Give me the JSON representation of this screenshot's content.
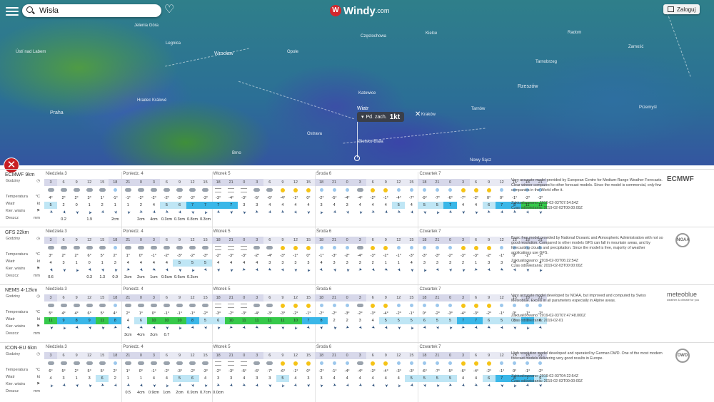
{
  "search": {
    "value": "Wisła"
  },
  "app": {
    "logo_letter": "W",
    "name": "Windy",
    "domain": ".com"
  },
  "login_label": "Zaloguj",
  "map": {
    "cities": [
      "Jelenia Góra",
      "Legnica",
      "Wrocław",
      "Ústí nad Labem",
      "Opole",
      "Częstochowa",
      "Kielce",
      "Radom",
      "Zamość",
      "Tarnobrzeg",
      "Rzeszów",
      "Hradec Králové",
      "Praha",
      "Katowice",
      "Kraków",
      "Ostrava",
      "Bielsko-Biała",
      "Brno",
      "Nowy Sącz",
      "Tarnów",
      "Przemyśl"
    ],
    "wind_title": "Wiatr",
    "wind_dir": "Pd. zach.",
    "wind_value": "1kt"
  },
  "colors": {
    "accent": "#d4272d",
    "hours_bg": "#e8e9f3",
    "wind_strong": "#35c94a",
    "wind_mid": "#3ab7e8"
  },
  "row_labels": {
    "hours": "Godziny",
    "temperature": "Temperatura",
    "temp_unit": "°C",
    "wind": "Wiatr",
    "wind_unit": "kt",
    "wind_dir": "Kier. wiatru",
    "precip": "Deszcz",
    "precip_unit": "mm"
  },
  "days": [
    "Niedziela 3",
    "Poniedz. 4",
    "Wtorek 5",
    "Środa 6",
    "Czwartek 7"
  ],
  "hours": [
    "3",
    "6",
    "9",
    "12",
    "15",
    "18",
    "21",
    "0",
    "3",
    "6",
    "9",
    "12",
    "15",
    "18",
    "21",
    "0",
    "3",
    "6",
    "9",
    "12",
    "15",
    "18",
    "21",
    "0",
    "3",
    "6",
    "9",
    "12",
    "15",
    "18",
    "21",
    "0",
    "3",
    "6",
    "9",
    "12",
    "15",
    "18",
    "21"
  ],
  "models": [
    {
      "name": "ECMWF 9km",
      "logo": "ECMWF",
      "description": "Very accurate model provided by European Centre for Medium-Range Weather Forecasts. Clear winner compared to other forecast models. Since the model is commercial, only few companies in the World offer it.",
      "updated": "Zaktualizowano: 2019-02-03T07:54:54Z",
      "refresh": "Czas odświeżania: 2019-02-03T00:00:00Z",
      "temps": [
        "4°",
        "2°",
        "2°",
        "3°",
        "1°",
        "-1°",
        "-1°",
        "-2°",
        "-2°",
        "-2°",
        "-3°",
        "-2°",
        "-3°",
        "-3°",
        "-4°",
        "-3°",
        "-5°",
        "-6°",
        "-4°",
        "-1°",
        "0°",
        "-2°",
        "-5°",
        "-4°",
        "-4°",
        "-2°",
        "-1°",
        "-4°",
        "-7°",
        "-9°",
        "-7°",
        "-6°",
        "-7°",
        "-2°",
        "0°",
        "0°",
        "-1°",
        "-2°",
        "-3°"
      ],
      "wind": [
        "5",
        "2",
        "0",
        "1",
        "2",
        "1",
        "1",
        "2",
        "4",
        "5",
        "6",
        "7",
        "7",
        "7",
        "7",
        "3",
        "3",
        "4",
        "4",
        "4",
        "4",
        "3",
        "4",
        "3",
        "4",
        "4",
        "4",
        "5",
        "4",
        "5",
        "5",
        "7",
        "4",
        "4",
        "6",
        "7",
        "8",
        "11",
        "11"
      ],
      "rain": [
        "",
        "0.2",
        "",
        "1.9",
        "",
        "2cm",
        "",
        "2cm",
        "4cm",
        "0.3cm",
        "0.3cm",
        "0.8cm",
        "0.3cm",
        "",
        "",
        "",
        "",
        "",
        "",
        "",
        "",
        "",
        "",
        "",
        "",
        "",
        "",
        "",
        "",
        "",
        "",
        "",
        "",
        "",
        "",
        "",
        "",
        "",
        ""
      ]
    },
    {
      "name": "GFS 22km",
      "logo": "NOAA",
      "description": "Basic free model provided by National Oceanic and Atmospheric Administration with not so good resolution. Compared to other models GFS can fall in mountain areas, and by forecasting clouds and precipitation. Since the model is free, majority of weather applications use GFS.",
      "updated": "Zaktualizowano: 2019-02-03T06:22:54Z",
      "refresh": "Czas odświeżania: 2019-02-03T00:00:00Z",
      "temps": [
        "3°",
        "2°",
        "2°",
        "6°",
        "5°",
        "2°",
        "1°",
        "0°",
        "-1°",
        "-2°",
        "-3°",
        "-2°",
        "-3°",
        "-2°",
        "-3°",
        "-3°",
        "-2°",
        "-4°",
        "-3°",
        "-1°",
        "0°",
        "-1°",
        "-3°",
        "-2°",
        "-4°",
        "-3°",
        "-2°",
        "-1°",
        "-3°",
        "-3°",
        "-3°",
        "-2°",
        "-3°",
        "-3°",
        "-2°",
        "-1°",
        "0°",
        "-1°",
        "-1°"
      ],
      "wind": [
        "4",
        "3",
        "1",
        "0",
        "1",
        "3",
        "4",
        "4",
        "4",
        "4",
        "5",
        "5",
        "5",
        "4",
        "4",
        "4",
        "4",
        "3",
        "3",
        "3",
        "3",
        "4",
        "3",
        "3",
        "3",
        "2",
        "1",
        "1",
        "4",
        "3",
        "3",
        "3",
        "2",
        "1",
        "3",
        "3",
        "4",
        "3",
        "4"
      ],
      "rain": [
        "0.6",
        "",
        "",
        "0.3",
        "1.3",
        "0.9",
        "2cm",
        "2cm",
        "1cm",
        "0.5cm",
        "0.6cm",
        "0.3cm",
        "",
        "",
        "",
        "",
        "",
        "",
        "",
        "",
        "",
        "",
        "",
        "",
        "",
        "",
        "",
        "",
        "",
        "",
        "",
        "",
        "",
        "",
        "",
        "",
        "",
        "",
        ""
      ]
    },
    {
      "name": "NEMS 4-12km",
      "logo": "meteoblue",
      "logo_sub": "weather & climate for you",
      "description": "Very accurate model developed by NOAA, but improved and computed by Swiss Meteoblue. Excels in all parameters especially in Alpine areas.",
      "updated": "Zaktualizowano: 2019-02-03T07:47:48.000Z",
      "refresh": "Czas odświeżania: 2019-02-01",
      "temps": [
        "5°",
        "4°",
        "4°",
        "6°",
        "5°",
        "4°",
        "2°",
        "1°",
        "0°",
        "-1°",
        "-1°",
        "-1°",
        "-2°",
        "-3°",
        "-2°",
        "-3°",
        "-4°",
        "-3°",
        "-3°",
        "-2°",
        "-1°",
        "-2°",
        "-2°",
        "-3°",
        "-2°",
        "-3°",
        "-4°",
        "-2°",
        "-1°",
        "0°",
        "-2°",
        "-3°",
        "-4°",
        "-3°",
        "-2°",
        "-1°",
        "0°",
        "-1°",
        "-2°"
      ],
      "wind": [
        "11",
        "9",
        "8",
        "9",
        "11",
        "8",
        "4",
        "6",
        "10",
        "10",
        "10",
        "8",
        "5",
        "6",
        "10",
        "11",
        "11",
        "11",
        "11",
        "10",
        "7",
        "8",
        "2",
        "2",
        "3",
        "4",
        "5",
        "5",
        "5",
        "6",
        "5",
        "5",
        "7",
        "7",
        "6",
        "5",
        "6",
        "7",
        "6"
      ],
      "rain": [
        "",
        "",
        "",
        "",
        "",
        "",
        "3cm",
        "4cm",
        "2cm",
        "0.7",
        "",
        "",
        "",
        "",
        "",
        "",
        "",
        "",
        "",
        "",
        "",
        "",
        "",
        "",
        "",
        "",
        "",
        "",
        "",
        "",
        "",
        "",
        "",
        "",
        "",
        "",
        "",
        "",
        ""
      ]
    },
    {
      "name": "ICON-EU 6km",
      "logo": "DWD",
      "description": "High resolution model developed and operated by German DWD. One of the most modern forecast models delivering very good results in Europe.",
      "updated": "Zaktualizowano: 2019-02-03T04:22:54Z",
      "refresh": "Czas odświeżania: 2019-02-03T00:00:00Z",
      "temps": [
        "6°",
        "5°",
        "2°",
        "5°",
        "5°",
        "2°",
        "1°",
        "0°",
        "-1°",
        "-2°",
        "-3°",
        "-2°",
        "-3°",
        "-2°",
        "-3°",
        "-5°",
        "-6°",
        "-7°",
        "-6°",
        "-1°",
        "0°",
        "-2°",
        "-1°",
        "-4°",
        "-4°",
        "-3°",
        "-4°",
        "-3°",
        "-3°",
        "-6°",
        "-7°",
        "-5°",
        "-6°",
        "-4°",
        "-2°",
        "-1°",
        "0°",
        "-1°",
        "-2°"
      ],
      "wind": [
        "4",
        "3",
        "1",
        "3",
        "6",
        "2",
        "1",
        "1",
        "4",
        "4",
        "5",
        "6",
        "4",
        "3",
        "3",
        "4",
        "3",
        "3",
        "5",
        "4",
        "3",
        "3",
        "4",
        "4",
        "4",
        "4",
        "4",
        "4",
        "5",
        "5",
        "5",
        "5",
        "4",
        "4",
        "6",
        "7",
        "8",
        "7",
        "5"
      ],
      "rain": [
        "",
        "",
        "",
        "",
        "",
        "",
        "0.5",
        "4cm",
        "0.9cm",
        "1cm",
        "2cm",
        "0.9cm",
        "0.7cm",
        "0.0cm",
        "",
        "",
        "",
        "",
        "",
        "",
        "",
        "",
        "",
        "",
        "",
        "",
        "",
        "",
        "",
        "",
        "",
        "",
        "",
        "",
        "",
        "",
        "",
        "",
        ""
      ]
    }
  ],
  "weather_icons": [
    "cloud",
    "cloud",
    "cloud",
    "cloud",
    "cloud",
    "moon",
    "cloud",
    "cloud",
    "cloud",
    "cloud",
    "cloud",
    "cloud",
    "cloud",
    "fog",
    "fog",
    "fog",
    "cloud",
    "cloud",
    "sun",
    "sun",
    "sun",
    "moon",
    "moon",
    "moon",
    "cloud",
    "sun",
    "sun",
    "moon",
    "moon",
    "moon",
    "moon",
    "moon",
    "sun",
    "sun",
    "sun",
    "moon",
    "moon",
    "moon",
    "moon"
  ]
}
